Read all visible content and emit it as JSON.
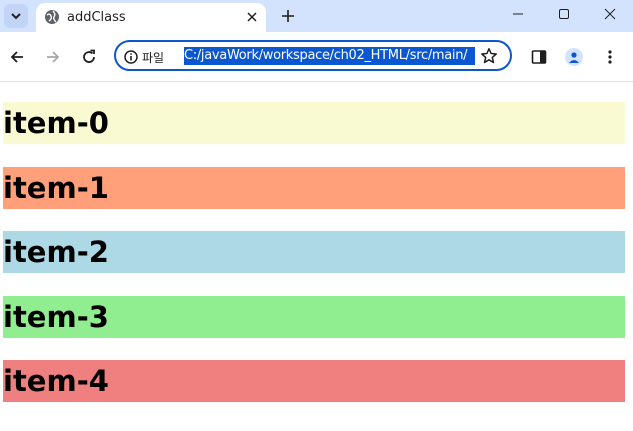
{
  "browser": {
    "tab": {
      "title": "addClass",
      "favicon": "globe-icon"
    },
    "address_bar": {
      "site_info_label": "파일",
      "url": "C:/javaWork/workspace/ch02_HTML/src/main/"
    }
  },
  "page": {
    "items": [
      {
        "label": "item-0",
        "color": "#fafad2"
      },
      {
        "label": "item-1",
        "color": "#ffa07a"
      },
      {
        "label": "item-2",
        "color": "#add8e6"
      },
      {
        "label": "item-3",
        "color": "#90ee90"
      },
      {
        "label": "item-4",
        "color": "#f08080"
      }
    ]
  },
  "colors": {
    "tabbar_bg": "#d3e3fd",
    "accent": "#0b57d0"
  }
}
